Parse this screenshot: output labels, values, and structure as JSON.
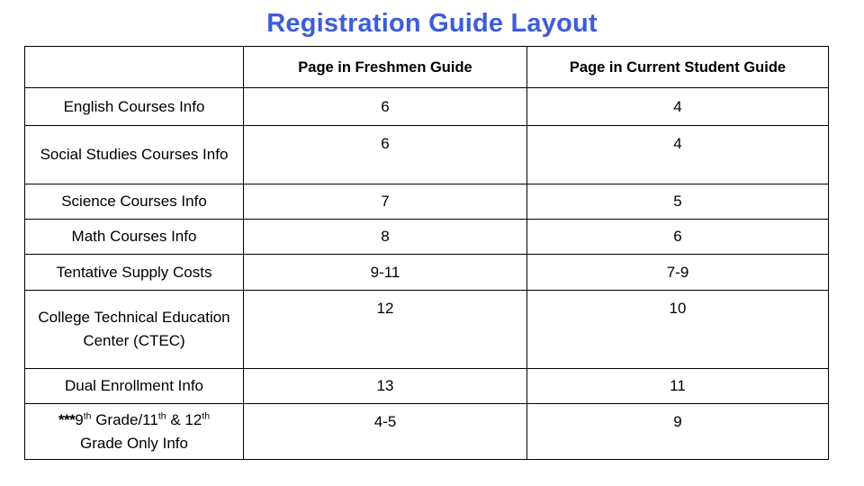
{
  "title": "Registration Guide Layout",
  "accent_color": "#3b5ce2",
  "table": {
    "headers": {
      "corner": "",
      "col2": "Page in Freshmen  Guide",
      "col3": "Page in Current Student Guide"
    },
    "rows": [
      {
        "label": "English Courses Info",
        "freshmen": "6",
        "current": "4"
      },
      {
        "label": "Social Studies Courses Info",
        "freshmen": "6",
        "current": "4"
      },
      {
        "label": "Science Courses Info",
        "freshmen": "7",
        "current": "5"
      },
      {
        "label": "Math Courses Info",
        "freshmen": "8",
        "current": "6"
      },
      {
        "label": "Tentative Supply Costs",
        "freshmen": "9-11",
        "current": "7-9"
      },
      {
        "label": "College Technical Education Center (CTEC)",
        "freshmen": "12",
        "current": "10"
      },
      {
        "label": "Dual Enrollment Info",
        "freshmen": "13",
        "current": "11"
      },
      {
        "label": "***9th Grade/11th & 12th Grade Only Info",
        "freshmen": "4-5",
        "current": "9"
      }
    ],
    "last_row_parts": {
      "stars": "***",
      "grade9": "9",
      "sup1": "th",
      "mid": " Grade/11",
      "sup2": "th",
      "amp": " & 12",
      "sup3": "th",
      "tail": "Grade Only Info"
    }
  }
}
